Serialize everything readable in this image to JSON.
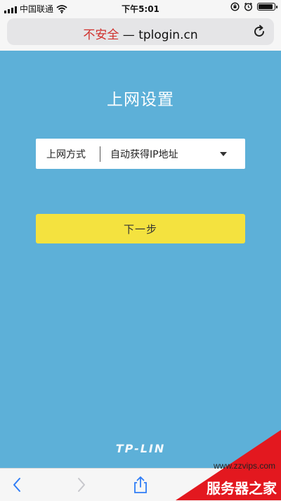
{
  "status_bar": {
    "carrier": "中国联通",
    "time": "下午5:01",
    "battery_level_percent": 90
  },
  "url_bar": {
    "insecure_label": "不安全",
    "separator": " — ",
    "domain": "tplogin.cn"
  },
  "page": {
    "title": "上网设置",
    "connection_label": "上网方式",
    "connection_value": "自动获得IP地址",
    "next_label": "下一步",
    "logo_text": "TP-LIN"
  },
  "watermark": {
    "site": "www.zzvips.com",
    "name": "服务器之家"
  },
  "colors": {
    "background": "#5db0d8",
    "button": "#f4e23f",
    "insecure": "#d0312d",
    "watermark": "#e3181f"
  },
  "icons": [
    "signal-icon",
    "wifi-icon",
    "rotation-lock-icon",
    "alarm-icon",
    "battery-icon",
    "reload-icon",
    "back-icon",
    "forward-icon",
    "share-icon"
  ]
}
